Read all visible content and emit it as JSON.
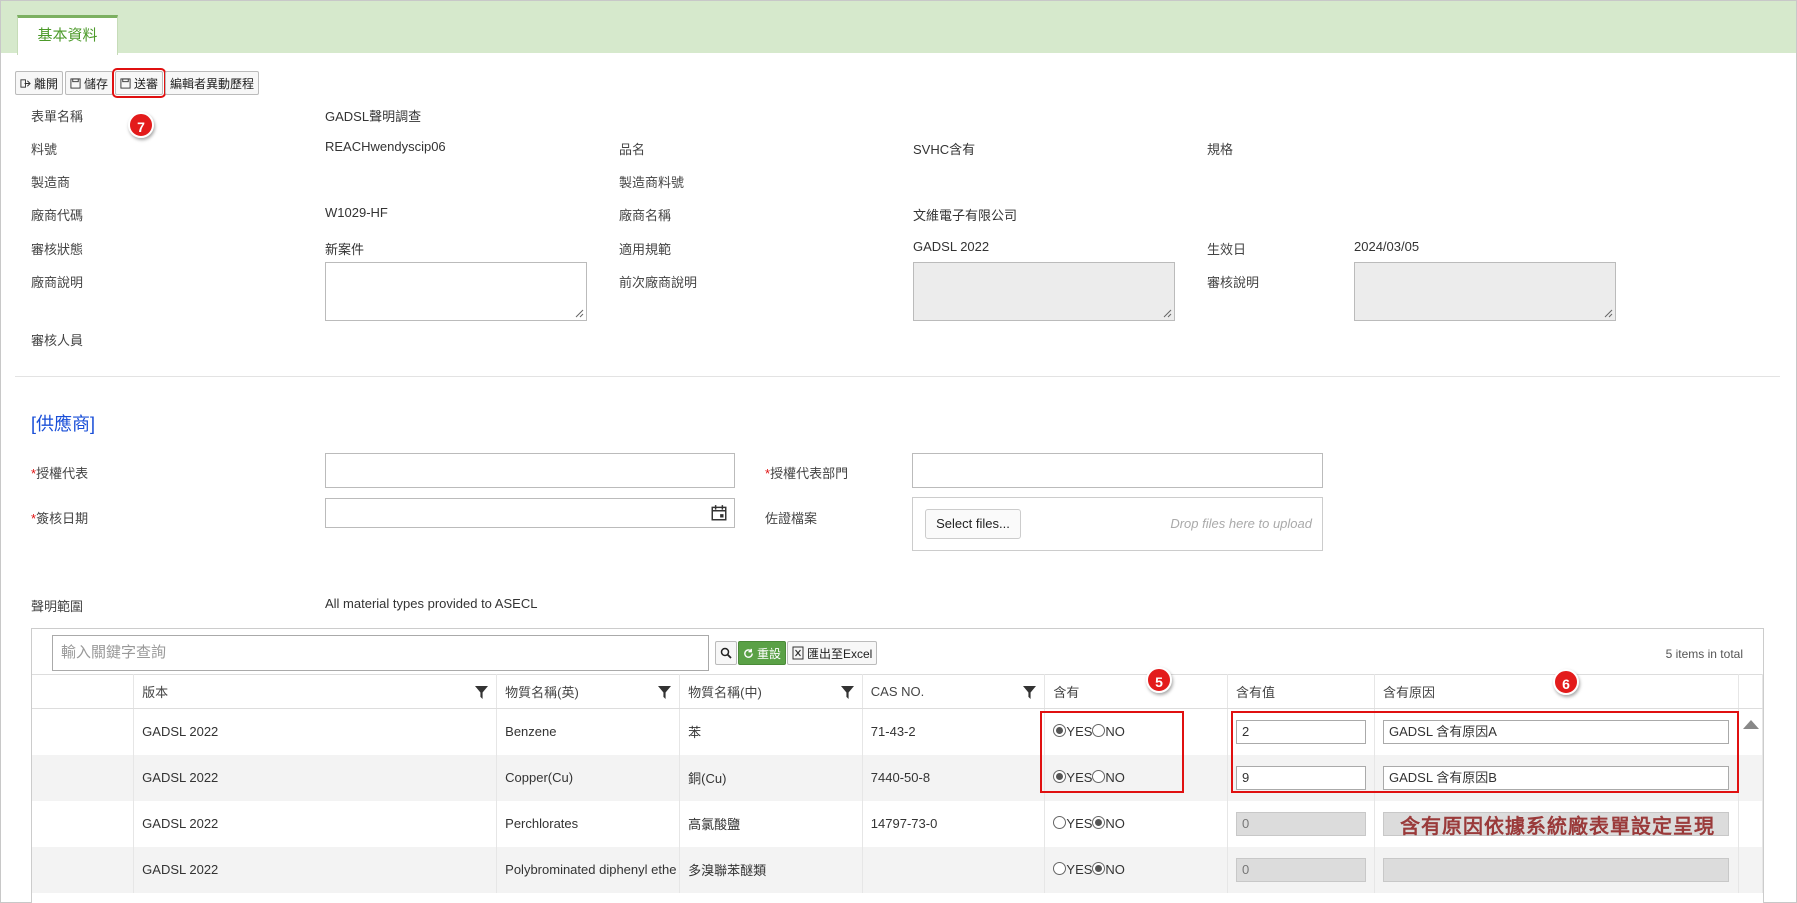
{
  "tab": {
    "label": "基本資料"
  },
  "toolbar": {
    "leave": "離開",
    "save": "儲存",
    "submit": "送審",
    "history": "編輯者異動歷程"
  },
  "badges": {
    "b5": "5",
    "b6": "6",
    "b7": "7"
  },
  "form": {
    "form_name_label": "表單名稱",
    "form_name_value": "GADSL聲明調查",
    "part_no_label": "料號",
    "part_no_value": "REACHwendyscip06",
    "product_name_label": "品名",
    "product_name_value": "SVHC含有",
    "spec_label": "規格",
    "manufacturer_label": "製造商",
    "mfr_part_no_label": "製造商料號",
    "vendor_code_label": "廠商代碼",
    "vendor_code_value": "W1029-HF",
    "vendor_name_label": "廠商名稱",
    "vendor_name_value": "文維電子有限公司",
    "review_status_label": "審核狀態",
    "review_status_value": "新案件",
    "regulation_label": "適用規範",
    "regulation_value": "GADSL 2022",
    "effective_date_label": "生效日",
    "effective_date_value": "2024/03/05",
    "vendor_note_label": "廠商說明",
    "prev_vendor_note_label": "前次廠商說明",
    "review_note_label": "審核說明",
    "reviewer_label": "審核人員"
  },
  "supplier": {
    "section_title": "[供應商]",
    "authorized_rep_label": "授權代表",
    "authorized_dept_label": "授權代表部門",
    "sign_date_label": "簽核日期",
    "evidence_label": "佐證檔案",
    "select_files": "Select files...",
    "drop_hint": "Drop files here to upload"
  },
  "scope": {
    "label": "聲明範圍",
    "value": "All material types provided to ASECL"
  },
  "grid": {
    "search_placeholder": "輸入關鍵字查詢",
    "reset": "重設",
    "export": "匯出至Excel",
    "total": "5 items in total",
    "headers": [
      "版本",
      "物質名稱(英)",
      "物質名稱(中)",
      "CAS NO.",
      "含有",
      "含有值",
      "含有原因"
    ],
    "yes": "YES",
    "no": "NO",
    "rows": [
      {
        "version": "GADSL 2022",
        "name_en": "Benzene",
        "name_zh": "苯",
        "cas": "71-43-2",
        "contains": "yes",
        "value": "2",
        "reason": "GADSL 含有原因A"
      },
      {
        "version": "GADSL 2022",
        "name_en": "Copper(Cu)",
        "name_zh": "銅(Cu)",
        "cas": "7440-50-8",
        "contains": "yes",
        "value": "9",
        "reason": "GADSL 含有原因B"
      },
      {
        "version": "GADSL 2022",
        "name_en": "Perchlorates",
        "name_zh": "高氯酸鹽",
        "cas": "14797-73-0",
        "contains": "no",
        "value": "0",
        "reason": ""
      },
      {
        "version": "GADSL 2022",
        "name_en": "Polybrominated diphenyl ethe",
        "name_zh": "多溴聯苯醚類",
        "cas": "",
        "contains": "no",
        "value": "0",
        "reason": ""
      }
    ]
  },
  "annotation": "含有原因依據系統廠表單設定呈現"
}
